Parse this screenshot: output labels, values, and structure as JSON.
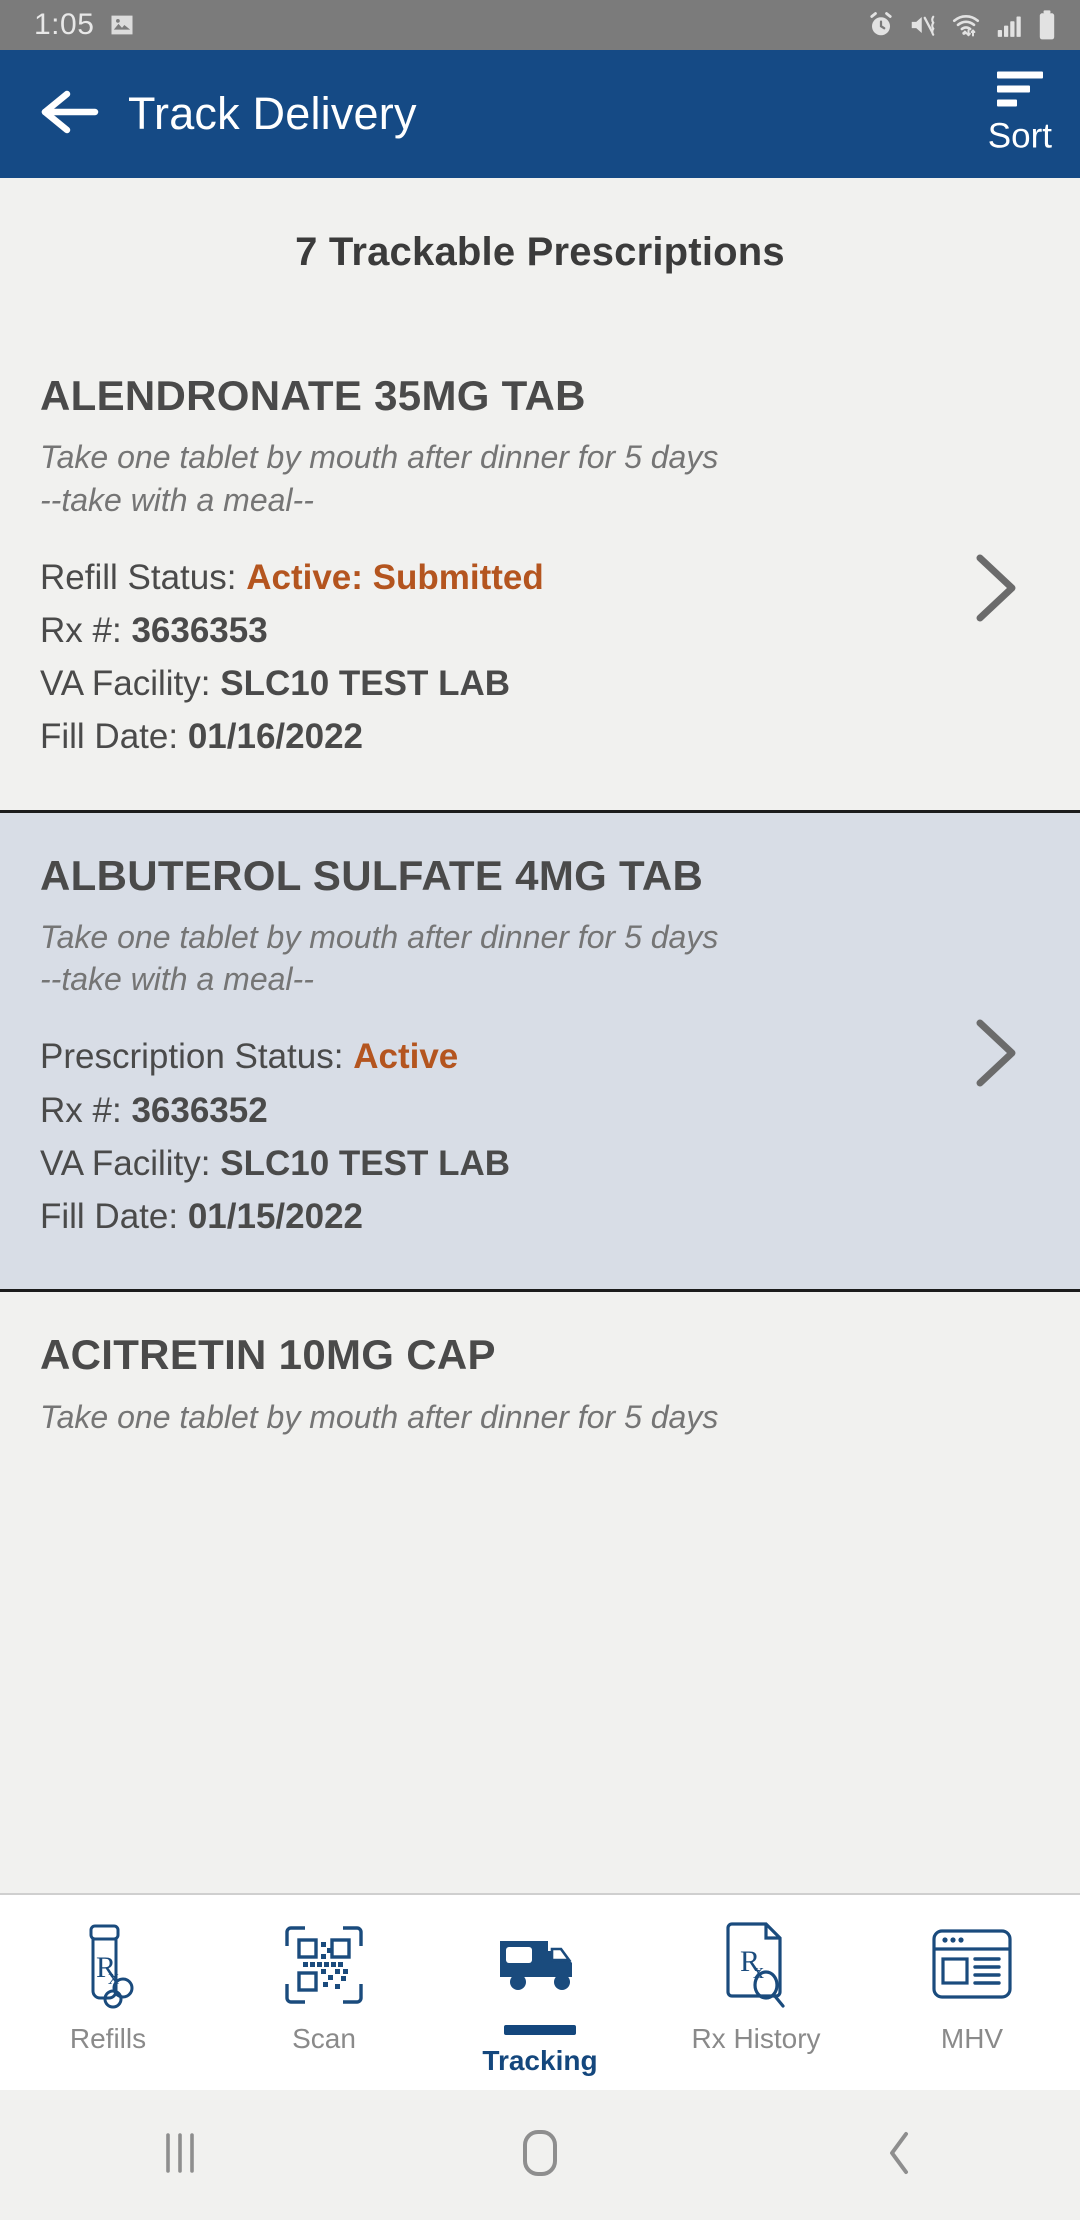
{
  "status_bar": {
    "time": "1:05",
    "left_icons": [
      "image-icon"
    ],
    "right_icons": [
      "alarm-icon",
      "mute-vibrate-icon",
      "wifi-icon",
      "cellular-signal-icon",
      "battery-icon"
    ]
  },
  "app_bar": {
    "title": "Track Delivery",
    "back_icon": "back-arrow-icon",
    "sort_label": "Sort",
    "sort_icon": "sort-icon",
    "background_color": "#154a85"
  },
  "list": {
    "heading": "7 Trackable Prescriptions",
    "count": 7,
    "chevron_icon": "chevron-right-icon",
    "status_color": "#b4551f",
    "items": [
      {
        "name": "ALENDRONATE 35MG TAB",
        "sig_line_1": "Take one tablet by mouth after dinner for 5 days",
        "sig_line_2": "--take with a meal--",
        "status_label": "Refill Status:",
        "status_value": "Active: Submitted",
        "rx_label": "Rx #:",
        "rx_value": "3636353",
        "facility_label": "VA Facility:",
        "facility_value": "SLC10 TEST LAB",
        "fill_date_label": "Fill Date:",
        "fill_date_value": "01/16/2022"
      },
      {
        "name": "ALBUTEROL SULFATE 4MG TAB",
        "sig_line_1": "Take one tablet by mouth after dinner for 5 days",
        "sig_line_2": "--take with a meal--",
        "status_label": "Prescription Status:",
        "status_value": "Active",
        "rx_label": "Rx #:",
        "rx_value": "3636352",
        "facility_label": "VA Facility:",
        "facility_value": "SLC10 TEST LAB",
        "fill_date_label": "Fill Date:",
        "fill_date_value": "01/15/2022"
      },
      {
        "name": "ACITRETIN 10MG CAP",
        "sig_line_1": "Take one tablet by mouth after dinner for 5 days"
      }
    ]
  },
  "tab_bar": {
    "active": "Tracking",
    "items": [
      {
        "label": "Refills",
        "icon": "pill-bottle-rx-icon"
      },
      {
        "label": "Scan",
        "icon": "qr-scan-icon"
      },
      {
        "label": "Tracking",
        "icon": "delivery-truck-icon"
      },
      {
        "label": "Rx History",
        "icon": "rx-document-search-icon"
      },
      {
        "label": "MHV",
        "icon": "web-page-icon"
      }
    ]
  },
  "system_nav": {
    "recents_icon": "recents-icon",
    "home_icon": "home-icon",
    "back_icon": "system-back-icon"
  }
}
